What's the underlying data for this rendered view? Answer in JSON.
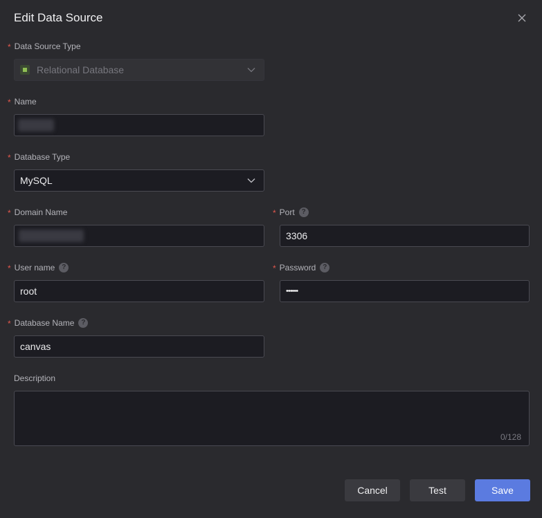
{
  "dialog": {
    "title": "Edit Data Source"
  },
  "form": {
    "data_source_type": {
      "label": "Data Source Type",
      "value": "Relational Database",
      "icon": "database-icon"
    },
    "name": {
      "label": "Name"
    },
    "database_type": {
      "label": "Database Type",
      "value": "MySQL"
    },
    "domain_name": {
      "label": "Domain Name"
    },
    "port": {
      "label": "Port",
      "value": "3306"
    },
    "user_name": {
      "label": "User name",
      "value": "root"
    },
    "password": {
      "label": "Password",
      "value": "••••••"
    },
    "database_name": {
      "label": "Database Name",
      "value": "canvas"
    },
    "description": {
      "label": "Description",
      "value": "",
      "counter": "0/128"
    },
    "required_marker": "*",
    "help_marker": "?"
  },
  "footer": {
    "cancel_label": "Cancel",
    "test_label": "Test",
    "save_label": "Save"
  },
  "colors": {
    "background": "#2a2a2e",
    "input_background": "#1c1c22",
    "primary": "#5b7be0",
    "required": "#e2574c"
  }
}
